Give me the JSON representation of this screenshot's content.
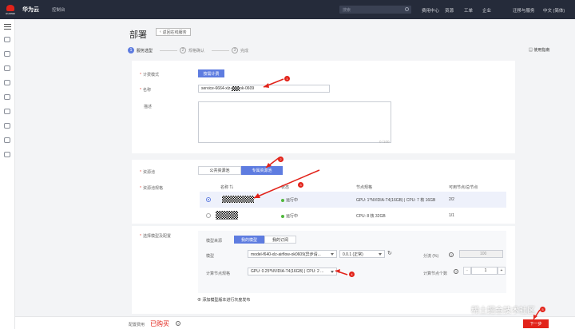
{
  "topbar": {
    "logo_text": "HUAWEI",
    "brand": "华为云",
    "console": "控制台",
    "search_placeholder": "搜索",
    "nav": [
      "费用中心",
      "资源",
      "工单",
      "企业",
      "迁移与服务",
      "中文 (简体)"
    ]
  },
  "page": {
    "title": "部署",
    "back_label": "返回在线服务",
    "guide_label": "使用指南",
    "steps": [
      {
        "num": "1",
        "label": "服务选型"
      },
      {
        "num": "2",
        "label": "规格确认"
      },
      {
        "num": "3",
        "label": "完成"
      }
    ]
  },
  "form": {
    "billing_label": "计费模式",
    "billing_value": "按需计费",
    "name_label": "名称",
    "name_prefix": "service-6664-xlz-",
    "name_suffix": "ok-0609",
    "desc_label": "描述",
    "desc_counter": "0 /100",
    "pool_label": "资源池",
    "pool_options": [
      "公共资源池",
      "专属资源池"
    ],
    "pool_spec_label": "资源池规格",
    "table_headers": [
      "名称",
      "状态",
      "节点规格",
      "可用节点/总节点"
    ],
    "pool_rows": [
      {
        "status": "运行中",
        "spec": "GPU: 1*NVIDIA-T4(16GB) | CPU: 7 核 16GB",
        "nodes": "2/2",
        "checked": true
      },
      {
        "status": "运行中",
        "spec": "CPU: 8 核 32GB",
        "nodes": "1/1",
        "checked": false
      }
    ],
    "model_label": "选择模型及配置",
    "model_source_label": "模型来源",
    "model_source_options": [
      "我的模型",
      "我的订阅"
    ],
    "model_field_label": "模型",
    "model_value": "model-f640-xlz-airflow-ok0609(异步请...",
    "model_version": "0.0.1 (正常)",
    "traffic_label": "分流 (%)",
    "traffic_value": "100",
    "node_spec_label": "计算节点规格",
    "node_spec_value": "GPU: 0.25*NVIDIA-T4(16GB) | CPU: 2 ...",
    "node_count_label": "计算节点个数",
    "node_count_value": "1",
    "add_version_label": "添加模型版本进行灰度发布"
  },
  "footer": {
    "spec_label": "配置费用",
    "purchased": "已购买",
    "next_label": "下一步"
  },
  "annotations": [
    "1",
    "2",
    "3",
    "4",
    "5"
  ],
  "watermark": "稀土掘金技术社区",
  "colors": {
    "topbar": "#252b3a",
    "primary": "#5e7ce0",
    "danger": "#e2231a",
    "running": "#50b83c"
  }
}
